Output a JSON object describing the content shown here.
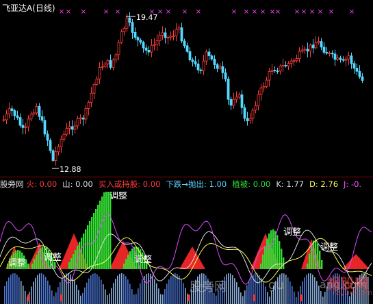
{
  "header": {
    "stock_name": "飞亚达A",
    "period": "(日线)"
  },
  "price_labels": {
    "high": "19.47",
    "low": "12.88"
  },
  "indicator": {
    "name": "股旁网",
    "items": [
      {
        "label": "火:",
        "value": "0.00",
        "color": "#ff3c3c"
      },
      {
        "label": "山:",
        "value": "0.00",
        "color": "#e0e0e0"
      },
      {
        "label": "买入或持股:",
        "value": "0.00",
        "color": "#ff3c3c"
      },
      {
        "label": "下跌→抛出:",
        "value": "1.00",
        "color": "#5ad2ff"
      },
      {
        "label": "植被:",
        "value": "0.00",
        "color": "#33dd33"
      },
      {
        "label": "K:",
        "value": "1.77",
        "color": "#e0e0e0"
      },
      {
        "label": "D:",
        "value": "2.76",
        "color": "#ffff55"
      },
      {
        "label": "J:",
        "value": "-0.",
        "color": "#ff55ff"
      }
    ],
    "adjust_label": "调整"
  },
  "watermark": {
    "text1": "股旁网",
    "text2": "gu",
    "text3": "ang.com",
    "text4": "报股网",
    "text5": "rayue.com"
  },
  "colors": {
    "up": "#ff3c3c",
    "down": "#54d8ff",
    "marker": "#ff44ff",
    "green": "#33dd33",
    "kline": "#e0e0e0",
    "dline": "#ffff55",
    "jline": "#d94cff"
  }
}
